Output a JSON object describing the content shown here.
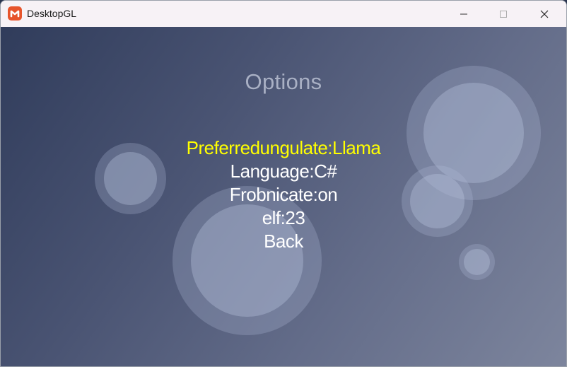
{
  "window": {
    "title": "DesktopGL",
    "icon": "monogame-logo-icon",
    "controls": [
      "minimize-icon",
      "maximize-icon",
      "close-icon"
    ]
  },
  "colors": {
    "selected_item": "#ffff00",
    "item": "#ffffff",
    "title": "#a9b0c4",
    "app_icon": "#e7542b"
  },
  "menu": {
    "title": "Options",
    "items": [
      {
        "label": "Preferredungulate:Llama",
        "selected": true
      },
      {
        "label": "Language:C#",
        "selected": false
      },
      {
        "label": "Frobnicate:on",
        "selected": false
      },
      {
        "label": "elf:23",
        "selected": false
      },
      {
        "label": "Back",
        "selected": false
      }
    ]
  }
}
